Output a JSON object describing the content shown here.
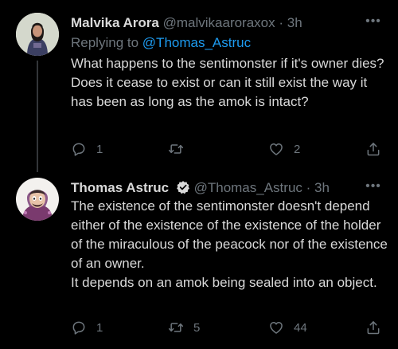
{
  "tweet1": {
    "name": "Malvika Arora",
    "handle": "@malvikaaroraxox",
    "separator": "·",
    "time": "3h",
    "more_label": "•••",
    "replying_prefix": "Replying to",
    "replying_mention": "@Thomas_Astruc",
    "text": "What happens to the sentimonster if it's owner dies? Does it cease to exist or can it still exist the way it has been as long as the amok is intact?",
    "reply_count": "1",
    "retweet_count": "",
    "like_count": "2"
  },
  "tweet2": {
    "name": "Thomas Astruc",
    "handle": "@Thomas_Astruc",
    "separator": "·",
    "time": "3h",
    "more_label": "•••",
    "text_lines": [
      "The existence of the sentimonster doesn't depend either of the existence of the existence of the holder of the miraculous of the peacock nor of the existence of an owner.",
      "It depends on an amok being sealed into an object."
    ],
    "reply_count": "1",
    "retweet_count": "5",
    "like_count": "44"
  },
  "icons": {
    "reply": "reply-icon",
    "retweet": "retweet-icon",
    "like": "like-icon",
    "share": "share-icon",
    "verified": "verified-badge-icon"
  },
  "colors": {
    "background": "#000000",
    "text": "#d9d9d9",
    "muted": "#6e767d",
    "link": "#1d9bf0"
  }
}
